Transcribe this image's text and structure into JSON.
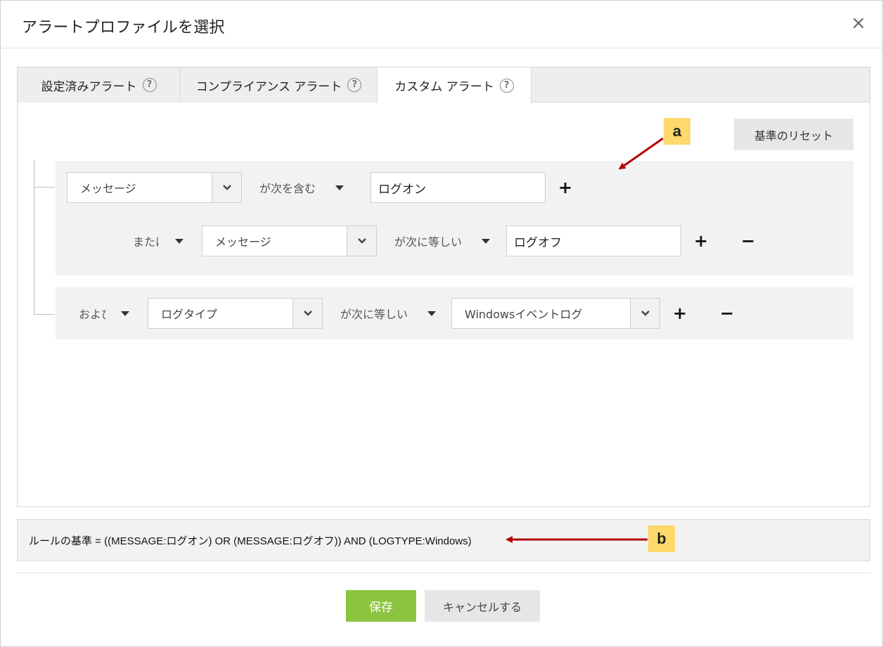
{
  "dialog": {
    "title": "アラートプロファイルを選択",
    "close_glyph": "×"
  },
  "tabs": [
    {
      "label": "設定済みアラート",
      "help": "?",
      "active": false
    },
    {
      "label": "コンプライアンス アラート",
      "help": "?",
      "active": false
    },
    {
      "label": "カスタム アラート",
      "help": "?",
      "active": true
    }
  ],
  "reset_button": "基準のリセット",
  "rules": {
    "row1": {
      "field": "メッセージ",
      "operator": "が次を含む",
      "value": "ログオン",
      "plus": "+"
    },
    "row2": {
      "conjunction": "または",
      "field": "メッセージ",
      "operator": "が次に等しい",
      "value": "ログオフ",
      "plus": "+",
      "minus": "−"
    },
    "row3": {
      "conjunction": "および",
      "field": "ログタイプ",
      "operator": "が次に等しい",
      "value": "Windowsイベントログ",
      "plus": "+",
      "minus": "−"
    }
  },
  "summary": "ルールの基準 = ((MESSAGE:ログオン) OR (MESSAGE:ログオフ)) AND (LOGTYPE:Windows)",
  "buttons": {
    "save": "保存",
    "cancel": "キャンセルする"
  },
  "annotations": {
    "a": "a",
    "b": "b",
    "callout_color": "#fdd86a",
    "arrow_color": "#b00000"
  },
  "colors": {
    "save": "#8cc43f",
    "panel_bg": "#f2f2f2"
  }
}
